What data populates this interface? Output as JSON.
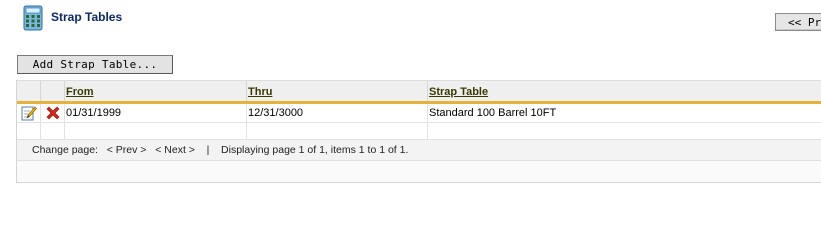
{
  "page": {
    "title": "Strap Tables",
    "header_icon": "calculator-icon",
    "prev_button_label": "<< Pr"
  },
  "toolbar": {
    "add_label": "Add Strap Table..."
  },
  "table": {
    "columns": [
      "From",
      "Thru",
      "Strap Table"
    ],
    "rows": [
      {
        "edit_icon": "edit-pencil-icon",
        "delete_icon": "delete-x-icon",
        "from": "01/31/1999",
        "thru": "12/31/3000",
        "strap_table": "Standard 100 Barrel 10FT"
      }
    ]
  },
  "pager": {
    "prefix": "Change page:",
    "prev": "< Prev >",
    "next": "< Next >",
    "separator": "|",
    "status": "Displaying page 1 of 1, items 1 to 1 of 1."
  },
  "colors": {
    "accent_gold": "#e6b23c",
    "title_blue": "#0a2a6e",
    "delete_red": "#d42a1a"
  }
}
